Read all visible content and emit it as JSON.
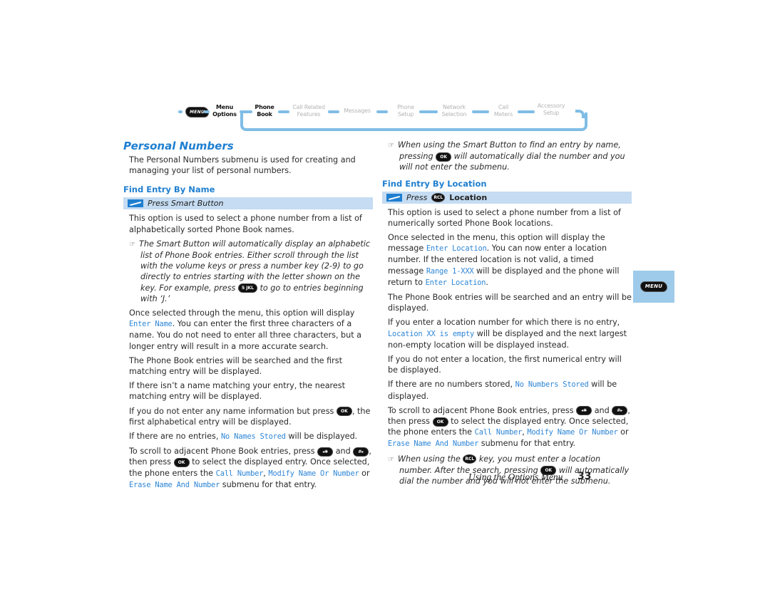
{
  "nav": {
    "menu_key": "MENU",
    "items": [
      {
        "line1": "Menu",
        "line2": "Options",
        "state": "active"
      },
      {
        "line1": "Phone",
        "line2": "Book",
        "state": "active"
      },
      {
        "line1": "Call Related",
        "line2": "Features",
        "state": "inactive"
      },
      {
        "line1": "Messages",
        "line2": "",
        "state": "inactive"
      },
      {
        "line1": "Phone",
        "line2": "Setup",
        "state": "inactive"
      },
      {
        "line1": "Network",
        "line2": "Selection",
        "state": "inactive"
      },
      {
        "line1": "Call",
        "line2": "Meters",
        "state": "inactive"
      },
      {
        "line1": "Accessory",
        "line2": "Setup",
        "state": "inactive"
      }
    ]
  },
  "left": {
    "title": "Personal Numbers",
    "intro": "The Personal Numbers submenu is used for creating and managing your list of personal numbers.",
    "subhead": "Find Entry By Name",
    "bar_text": "Press Smart Button",
    "p1": "This option is used to select a phone number from a list of alphabetically sorted Phone Book names.",
    "note1_a": "The Smart Button will automatically display an alphabetic list of Phone Book entries. Either scroll through the list with the volume keys or press a number key (2-9) to go directly to entries starting with the letter shown on the key. For example, press",
    "note1_key": "5 JKL",
    "note1_b": "to go to entries beginning with ‘J.’",
    "p2_a": "Once selected through the menu, this option will display",
    "p2_code": "Enter Name",
    "p2_b": ". You can enter the first three characters of a name. You do not need to enter all three characters, but a longer entry will result in a more accurate search.",
    "p3": "The Phone Book entries will be searched and the first matching entry will be displayed.",
    "p4": "If there isn’t a name matching your entry, the nearest matching entry will be displayed.",
    "p5_a": "If you do not enter any name information but press",
    "p5_b": ", the first alphabetical entry will be displayed.",
    "p6_a": "If there are no entries,",
    "p6_code": "No Names Stored",
    "p6_b": "will be displayed.",
    "p7_a": "To scroll to adjacent Phone Book entries, press",
    "p7_and": "and",
    "p7_b": ", then press",
    "p7_c": "to select the displayed entry. Once selected, the phone enters the",
    "p7_code1": "Call Number",
    "p7_comma": ",",
    "p7_code2": "Modify Name Or Number",
    "p7_or": "or",
    "p7_code3": "Erase Name And Number",
    "p7_d": "submenu for that entry."
  },
  "right": {
    "note1_a": "When using the Smart Button to find an entry by name, pressing",
    "note1_b": "will automatically dial the number and you will not enter the submenu.",
    "subhead": "Find Entry By Location",
    "bar_press": "Press",
    "bar_key": "RCL",
    "bar_location": "Location",
    "p1": "This option is used to select a phone number from a list of numerically sorted Phone Book locations.",
    "p2_a": "Once selected in the menu, this option will display the message",
    "p2_code1": "Enter Location",
    "p2_b": ". You can now enter a location number. If the entered location is not valid, a timed message",
    "p2_code2": "Range 1-XXX",
    "p2_c": "will be displayed and the phone will return to",
    "p2_code3": "Enter Location",
    "p2_d": ".",
    "p3": "The Phone Book entries will be searched and an entry will be displayed.",
    "p4_a": "If you enter a location number for which there is no entry,",
    "p4_code": "Location XX is empty",
    "p4_b": "will be displayed and the next largest non-empty location will be displayed instead.",
    "p5": "If you do not enter a location, the first numerical entry will be displayed.",
    "p6_a": "If there are no numbers stored,",
    "p6_code": "No Numbers Stored",
    "p6_b": "will be displayed.",
    "p7_a": "To scroll to adjacent Phone Book entries, press",
    "p7_and": "and",
    "p7_b": ", then press",
    "p7_c": "to select the displayed entry. Once selected, the phone enters the",
    "p7_code1": "Call Number",
    "p7_comma": ",",
    "p7_code2": "Modify Name Or Number",
    "p7_or": "or",
    "p7_code3": "Erase Name And Number",
    "p7_d": "submenu for that entry.",
    "note2_a": "When using the",
    "note2_key": "RCL",
    "note2_b": "key, you must enter a location number. After the search, pressing",
    "note2_c": "will automatically dial the number and you will not enter the submenu."
  },
  "keys": {
    "ok": "OK",
    "left_star": "◂✱",
    "hash_right": "#▸",
    "menu": "MENU"
  },
  "side_tab": {
    "key": "MENU"
  },
  "footer": {
    "chapter": "Using the Options Menu",
    "page": "33"
  }
}
